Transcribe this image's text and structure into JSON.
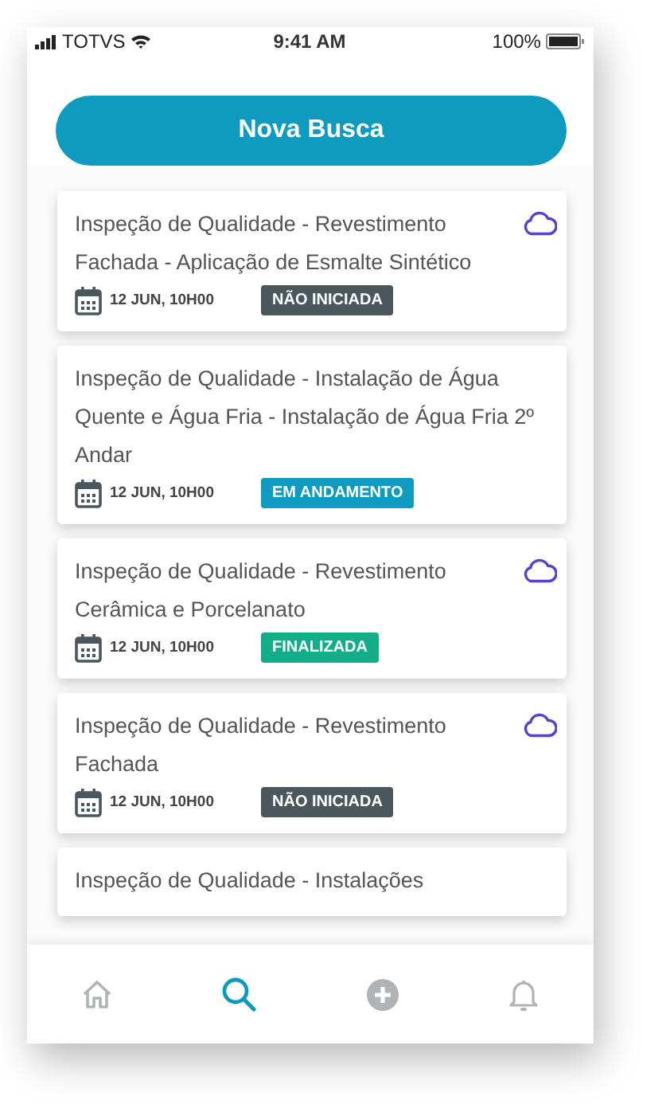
{
  "status_bar": {
    "carrier": "TOTVS",
    "time": "9:41 AM",
    "battery": "100%"
  },
  "new_search_button": "Nova Busca",
  "inspections": [
    {
      "title": "Inspeção de Qualidade - Revestimento Fachada  - Aplicação de Esmalte Sintético",
      "date": "12 JUN, 10H00",
      "status": "NÃO INICIADA",
      "color": "#4a585e",
      "synced": true
    },
    {
      "title": "Inspeção de Qualidade -  Instalação de Água Quente e Água Fria - Instalação de Água Fria 2º Andar",
      "date": "12 JUN, 10H00",
      "status": "EM ANDAMENTO",
      "color": "#0f9bbf",
      "synced": false
    },
    {
      "title": "Inspeção de Qualidade -  Revestimento Cerâmica e Porcelanato",
      "date": "12 JUN, 10H00",
      "status": "FINALIZADA",
      "color": "#12ae8a",
      "synced": true
    },
    {
      "title": "Inspeção de Qualidade - Revestimento Fachada",
      "date": "12 JUN, 10H00",
      "status": "NÃO INICIADA",
      "color": "#4a585e",
      "synced": true
    },
    {
      "title": "Inspeção de Qualidade - Instalações"
    }
  ],
  "tab_bar": [
    {
      "kind": "home",
      "selected": false
    },
    {
      "kind": "search",
      "selected": true
    },
    {
      "kind": "add",
      "selected": false
    },
    {
      "kind": "bell",
      "selected": false
    }
  ]
}
